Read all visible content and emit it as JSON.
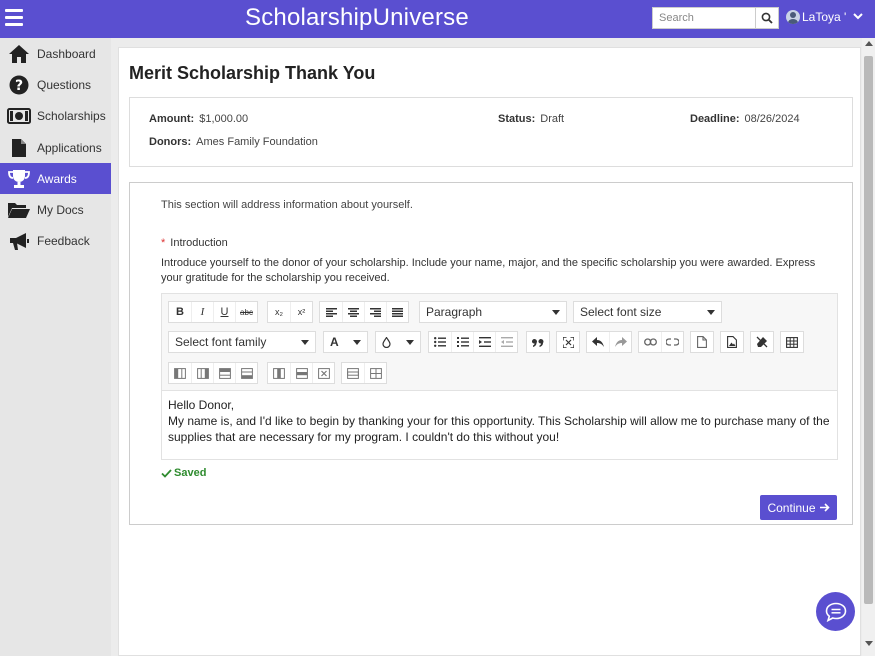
{
  "header": {
    "brand": "ScholarshipUniverse",
    "search_placeholder": "Search",
    "user_name": "LaToya '"
  },
  "sidebar": {
    "items": [
      {
        "label": "Dashboard",
        "icon": "home-icon"
      },
      {
        "label": "Questions",
        "icon": "question-icon"
      },
      {
        "label": "Scholarships",
        "icon": "money-icon"
      },
      {
        "label": "Applications",
        "icon": "document-icon"
      },
      {
        "label": "Awards",
        "icon": "trophy-icon",
        "active": true
      },
      {
        "label": "My Docs",
        "icon": "folder-open-icon"
      },
      {
        "label": "Feedback",
        "icon": "megaphone-icon"
      }
    ]
  },
  "page": {
    "title": "Merit Scholarship Thank You",
    "info": {
      "amount_label": "Amount:",
      "amount_value": "$1,000.00",
      "status_label": "Status:",
      "status_value": "Draft",
      "deadline_label": "Deadline:",
      "deadline_value": "08/26/2024",
      "donors_label": "Donors:",
      "donors_value": "Ames Family Foundation"
    },
    "form": {
      "section_note": "This section will address information about yourself.",
      "required_mark": "*",
      "question_label": "Introduction",
      "instructions": "Introduce yourself to the donor of your scholarship. Include your name, major, and the specific scholarship you were awarded. Express your gratitude for the scholarship you received.",
      "editor": {
        "block_format": "Paragraph",
        "font_size_placeholder": "Select font size",
        "font_family_placeholder": "Select font family",
        "font_color_label": "A",
        "bold": "B",
        "italic": "I",
        "underline": "U",
        "strike": "abc",
        "subscript": "x₂",
        "superscript": "x²",
        "content_line1": "Hello Donor,",
        "content_line2": "My name is, and I'd like to begin by thanking your for this opportunity. This Scholarship will allow me to purchase many of the supplies that are necessary for my program.  I couldn't do this without you!"
      },
      "saved_label": "Saved",
      "continue_label": "Continue"
    }
  },
  "colors": {
    "accent": "#5a4fd0",
    "saved": "#2e8b2e"
  }
}
